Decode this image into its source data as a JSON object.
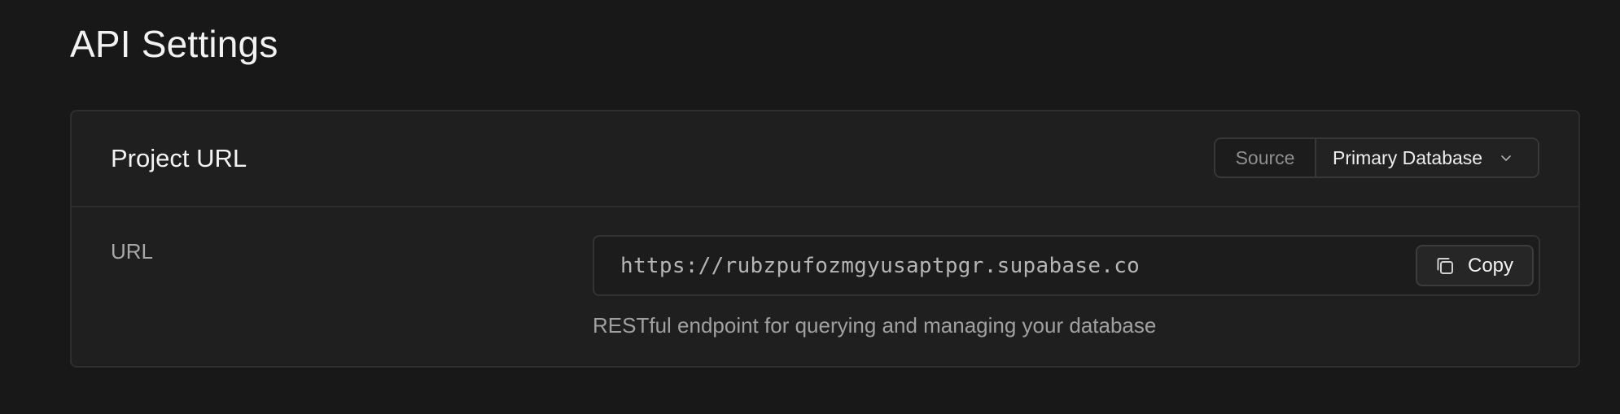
{
  "page": {
    "title": "API Settings"
  },
  "card": {
    "title": "Project URL",
    "source": {
      "label": "Source",
      "selected": "Primary Database",
      "icon": "chevron-down-icon"
    },
    "url": {
      "label": "URL",
      "value": "https://rubzpufozmgyusaptpgr.supabase.co",
      "copy_label": "Copy",
      "copy_icon": "copy-icon",
      "helper": "RESTful endpoint for querying and managing your database"
    }
  },
  "colors": {
    "background": "#181818",
    "card": "#1f1f1f",
    "border": "#2e2e2e",
    "text_primary": "#f2f2f2",
    "text_muted": "#a0a0a0"
  }
}
